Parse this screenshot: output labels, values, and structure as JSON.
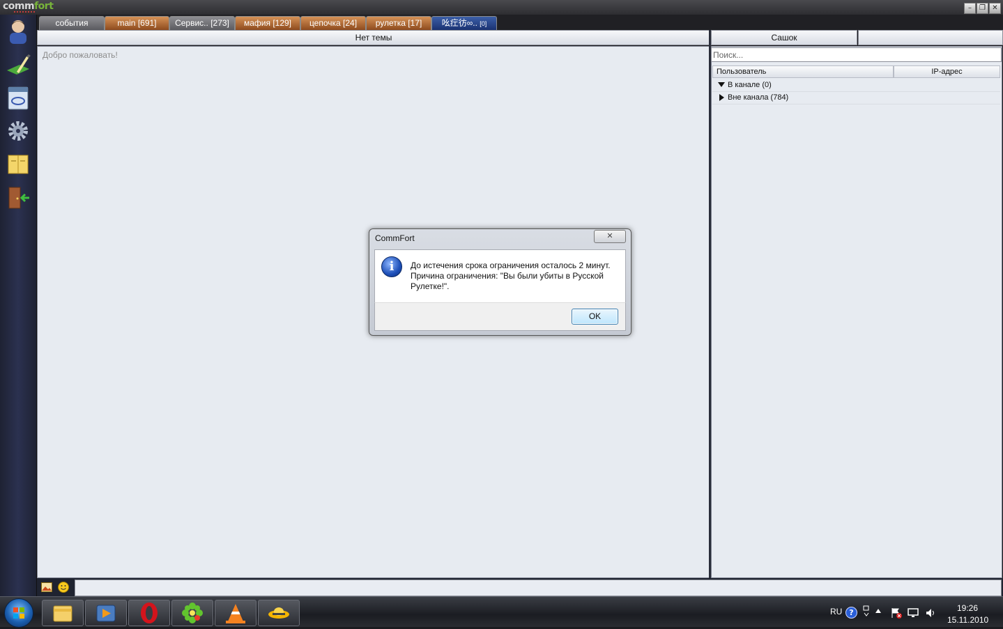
{
  "app": {
    "logo_a": "comm",
    "logo_b": "fort"
  },
  "window_controls": {
    "minimize": "–",
    "restore": "❐",
    "close": "✕"
  },
  "tabs": [
    {
      "label": "события",
      "style": "grey"
    },
    {
      "label": "main [691]",
      "style": "orange"
    },
    {
      "label": "Сервис.. [273]",
      "style": "grey"
    },
    {
      "label": "мафия [129]",
      "style": "orange"
    },
    {
      "label": "цепочка [24]",
      "style": "orange"
    },
    {
      "label": "рулетка [17]",
      "style": "orange"
    },
    {
      "label": "吆疘彷∞..",
      "badge": "[0]",
      "style": "blue"
    }
  ],
  "left_toolbar": [
    "user-icon",
    "edit-icon",
    "channels-icon",
    "settings-icon",
    "book-icon",
    "exit-door-icon"
  ],
  "chat": {
    "topic": "Нет темы",
    "welcome": "Добро пожаловать!"
  },
  "userlist": {
    "header_name": "Сашок",
    "search_placeholder": "Поиск...",
    "col_user": "Пользователь",
    "col_ip": "IP-адрес",
    "groups": [
      {
        "label": "В канале (0)",
        "expanded": true
      },
      {
        "label": "Вне канала (784)",
        "expanded": false
      }
    ]
  },
  "dialog": {
    "title": "CommFort",
    "close_glyph": "✕",
    "icon_glyph": "i",
    "line1": "До истечения срока ограничения осталось 2 минут.",
    "line2": "Причина ограничения: \"Вы были убиты в Русской",
    "line3": "Рулетке!\".",
    "ok": "OK"
  },
  "taskbar": {
    "lang": "RU",
    "time": "19:26",
    "date": "15.11.2010",
    "apps": [
      "explorer-icon",
      "media-player-icon",
      "opera-icon",
      "icq-icon",
      "vlc-icon",
      "commfort-icon"
    ]
  },
  "colors": {
    "accent_orange": "#d69256",
    "active_tab": "#3c5fa8",
    "panel_bg": "#e7ebf1"
  }
}
